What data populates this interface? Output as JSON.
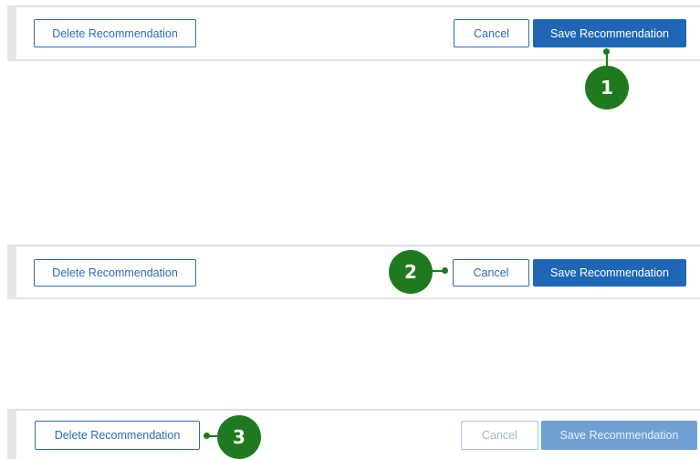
{
  "panels": [
    {
      "delete_label": "Delete Recommendation",
      "cancel_label": "Cancel",
      "save_label": "Save Recommendation",
      "callout": "1",
      "state": "default"
    },
    {
      "delete_label": "Delete Recommendation",
      "cancel_label": "Cancel",
      "save_label": "Save Recommendation",
      "callout": "2",
      "state": "default"
    },
    {
      "delete_label": "Delete Recommendation",
      "cancel_label": "Cancel",
      "save_label": "Save Recommendation",
      "callout": "3",
      "state": "cancel-and-save-disabled"
    }
  ],
  "colors": {
    "primary": "#1f67b5",
    "primary_disabled": "#6f9fd3",
    "callout": "#1f7a1f"
  },
  "icons": {
    "callout_marker": "numbered-circle-callout"
  }
}
